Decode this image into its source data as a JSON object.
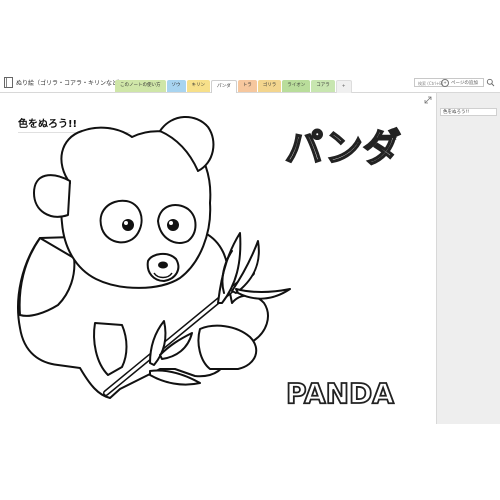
{
  "window": {
    "notebook_title": "ぬり絵（ゴリラ・コアラ・キリンなど）"
  },
  "tabs": [
    {
      "label": "このノートの使い方",
      "color": "#cfe6a8"
    },
    {
      "label": "ゾウ",
      "color": "#a8d4f0"
    },
    {
      "label": "キリン",
      "color": "#f7e08a"
    },
    {
      "label": "パンダ",
      "color": "#ffffff",
      "active": true
    },
    {
      "label": "トラ",
      "color": "#f6c79e"
    },
    {
      "label": "ゴリラ",
      "color": "#f3d58e"
    },
    {
      "label": "ライオン",
      "color": "#b9dd9b"
    },
    {
      "label": "コアラ",
      "color": "#c8e6b0"
    },
    {
      "label": "+",
      "color": "#f0f0f0"
    }
  ],
  "search": {
    "placeholder": "検索 (Ctrl+E)"
  },
  "page": {
    "heading": "色をぬろう!!",
    "katakana_title": "パンダ",
    "english_title": "PANDA"
  },
  "panel": {
    "add_page_label": "ページの追加",
    "pages": [
      "色をぬろう!!"
    ]
  }
}
